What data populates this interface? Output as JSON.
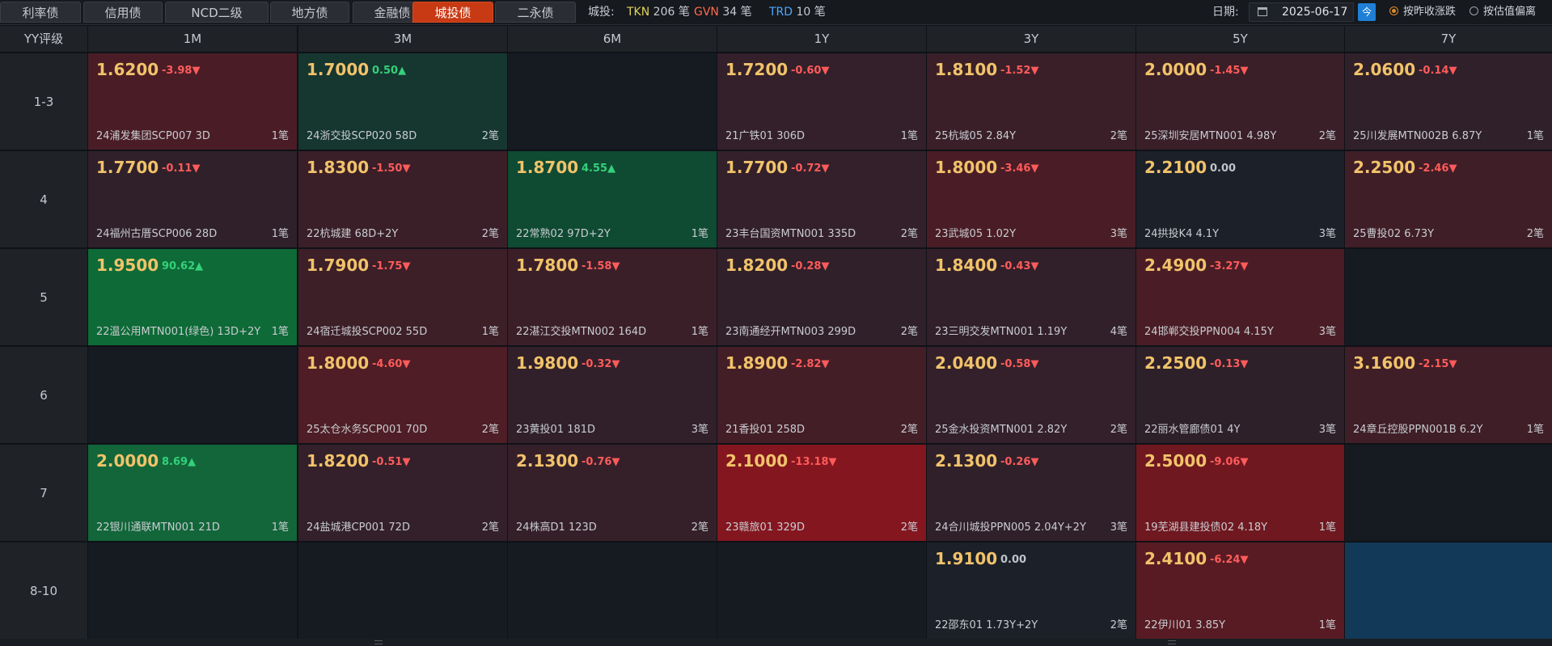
{
  "tabs": [
    {
      "label": "利率债",
      "active": false
    },
    {
      "label": "信用债",
      "active": false
    },
    {
      "label": "NCD二级",
      "active": false
    },
    {
      "label": "地方债",
      "active": false
    },
    {
      "label": "金融债",
      "active": false
    },
    {
      "label": "城投债",
      "active": true
    },
    {
      "label": "二永债",
      "active": false
    }
  ],
  "stats": {
    "prefix": "城投:",
    "tkn": {
      "label": "TKN",
      "count": "206 笔",
      "color": "#e0d35a"
    },
    "gvn": {
      "label": "GVN",
      "count": "34 笔",
      "color": "#ff6a4a"
    },
    "trd": {
      "label": "TRD",
      "count": "10 笔",
      "color": "#4aa8ff"
    }
  },
  "date": {
    "label": "日期:",
    "value": "2025-06-17",
    "today_button": "今",
    "calendar_icon": "calendar-icon"
  },
  "radios": [
    {
      "label": "按昨收涨跌",
      "checked": true
    },
    {
      "label": "按估值偏离",
      "checked": false
    }
  ],
  "grid": {
    "corner": "YY评级",
    "columns": [
      "1M",
      "3M",
      "6M",
      "1Y",
      "3Y",
      "5Y",
      "7Y"
    ],
    "rows": [
      {
        "label": "1-3",
        "cells": [
          {
            "price": "1.6200",
            "change": "-3.98▼",
            "dir": "dn",
            "bond": "24浦发集团SCP007 3D",
            "count": "1笔",
            "bg": "#4a1d26"
          },
          {
            "price": "1.7000",
            "change": "0.50▲",
            "dir": "up",
            "bond": "24浙交投SCP020 58D",
            "count": "2笔",
            "bg": "#163630"
          },
          null,
          {
            "price": "1.7200",
            "change": "-0.60▼",
            "dir": "dn",
            "bond": "21广铁01 306D",
            "count": "1笔",
            "bg": "#33202a"
          },
          {
            "price": "1.8100",
            "change": "-1.52▼",
            "dir": "dn",
            "bond": "25杭城05 2.84Y",
            "count": "2笔",
            "bg": "#3a1f28"
          },
          {
            "price": "2.0000",
            "change": "-1.45▼",
            "dir": "dn",
            "bond": "25深圳安居MTN001 4.98Y",
            "count": "2笔",
            "bg": "#3a1f28"
          },
          {
            "price": "2.0600",
            "change": "-0.14▼",
            "dir": "dn",
            "bond": "25川发展MTN002B 6.87Y",
            "count": "1笔",
            "bg": "#2f2029"
          }
        ]
      },
      {
        "label": "4",
        "cells": [
          {
            "price": "1.7700",
            "change": "-0.11▼",
            "dir": "dn",
            "bond": "24福州古厝SCP006 28D",
            "count": "1笔",
            "bg": "#30202a"
          },
          {
            "price": "1.8300",
            "change": "-1.50▼",
            "dir": "dn",
            "bond": "22杭城建 68D+2Y",
            "count": "2笔",
            "bg": "#3a1f28"
          },
          {
            "price": "1.8700",
            "change": "4.55▲",
            "dir": "up",
            "bond": "22常熟02 97D+2Y",
            "count": "1笔",
            "bg": "#0f4a32"
          },
          {
            "price": "1.7700",
            "change": "-0.72▼",
            "dir": "dn",
            "bond": "23丰台国资MTN001 335D",
            "count": "2笔",
            "bg": "#33202a"
          },
          {
            "price": "1.8000",
            "change": "-3.46▼",
            "dir": "dn",
            "bond": "23武城05 1.02Y",
            "count": "3笔",
            "bg": "#4a1d26"
          },
          {
            "price": "2.2100",
            "change": "0.00",
            "dir": "flat",
            "bond": "24拱投K4 4.1Y",
            "count": "3笔",
            "bg": "#1b2029"
          },
          {
            "price": "2.2500",
            "change": "-2.46▼",
            "dir": "dn",
            "bond": "25曹投02 6.73Y",
            "count": "2笔",
            "bg": "#3f1e27"
          }
        ]
      },
      {
        "label": "5",
        "cells": [
          {
            "price": "1.9500",
            "change": "90.62▲",
            "dir": "up",
            "bond": "22温公用MTN001(绿色) 13D+2Y",
            "count": "1笔",
            "bg": "#0e6a37"
          },
          {
            "price": "1.7900",
            "change": "-1.75▼",
            "dir": "dn",
            "bond": "24宿迁城投SCP002 55D",
            "count": "1笔",
            "bg": "#3d1f28"
          },
          {
            "price": "1.7800",
            "change": "-1.58▼",
            "dir": "dn",
            "bond": "22湛江交投MTN002 164D",
            "count": "1笔",
            "bg": "#3b1f28"
          },
          {
            "price": "1.8200",
            "change": "-0.28▼",
            "dir": "dn",
            "bond": "23南通经开MTN003 299D",
            "count": "2笔",
            "bg": "#30202a"
          },
          {
            "price": "1.8400",
            "change": "-0.43▼",
            "dir": "dn",
            "bond": "23三明交发MTN001 1.19Y",
            "count": "4笔",
            "bg": "#31202a"
          },
          {
            "price": "2.4900",
            "change": "-3.27▼",
            "dir": "dn",
            "bond": "24邯郸交投PPN004 4.15Y",
            "count": "3笔",
            "bg": "#4a1d26"
          },
          null
        ]
      },
      {
        "label": "6",
        "cells": [
          null,
          {
            "price": "1.8000",
            "change": "-4.60▼",
            "dir": "dn",
            "bond": "25太仓水务SCP001 70D",
            "count": "2笔",
            "bg": "#4e1d25"
          },
          {
            "price": "1.9800",
            "change": "-0.32▼",
            "dir": "dn",
            "bond": "23黄投01 181D",
            "count": "3笔",
            "bg": "#31202a"
          },
          {
            "price": "1.8900",
            "change": "-2.82▼",
            "dir": "dn",
            "bond": "21香投01 258D",
            "count": "2笔",
            "bg": "#441e27"
          },
          {
            "price": "2.0400",
            "change": "-0.58▼",
            "dir": "dn",
            "bond": "25金水投资MTN001 2.82Y",
            "count": "2笔",
            "bg": "#33202a"
          },
          {
            "price": "2.2500",
            "change": "-0.13▼",
            "dir": "dn",
            "bond": "22丽水管廊债01 4Y",
            "count": "3笔",
            "bg": "#2e2029"
          },
          {
            "price": "3.1600",
            "change": "-2.15▼",
            "dir": "dn",
            "bond": "24章丘控股PPN001B 6.2Y",
            "count": "1笔",
            "bg": "#3f1e27"
          }
        ]
      },
      {
        "label": "7",
        "cells": [
          {
            "price": "2.0000",
            "change": "8.69▲",
            "dir": "up",
            "bond": "22银川通联MTN001 21D",
            "count": "1笔",
            "bg": "#12663a"
          },
          {
            "price": "1.8200",
            "change": "-0.51▼",
            "dir": "dn",
            "bond": "24盐城港CP001 72D",
            "count": "2笔",
            "bg": "#33202a"
          },
          {
            "price": "2.1300",
            "change": "-0.76▼",
            "dir": "dn",
            "bond": "24株高D1 123D",
            "count": "2笔",
            "bg": "#35202a"
          },
          {
            "price": "2.1000",
            "change": "-13.18▼",
            "dir": "dn",
            "bond": "23赣旅01 329D",
            "count": "2笔",
            "bg": "#84161f"
          },
          {
            "price": "2.1300",
            "change": "-0.26▼",
            "dir": "dn",
            "bond": "24合川城投PPN005 2.04Y+2Y",
            "count": "3笔",
            "bg": "#30202a"
          },
          {
            "price": "2.5000",
            "change": "-9.06▼",
            "dir": "dn",
            "bond": "19芜湖县建投债02 4.18Y",
            "count": "1笔",
            "bg": "#6f1820"
          },
          null
        ]
      },
      {
        "label": "8-10",
        "cells": [
          null,
          null,
          null,
          null,
          {
            "price": "1.9100",
            "change": "0.00",
            "dir": "flat",
            "bond": "22邵东01 1.73Y+2Y",
            "count": "2笔",
            "bg": "#1b2029"
          },
          {
            "price": "2.4100",
            "change": "-6.24▼",
            "dir": "dn",
            "bond": "22伊川01 3.85Y",
            "count": "1笔",
            "bg": "#581b23"
          },
          {
            "price": "",
            "change": "",
            "dir": "flat",
            "bond": "",
            "count": "",
            "bg": "#123a58"
          }
        ]
      }
    ]
  }
}
